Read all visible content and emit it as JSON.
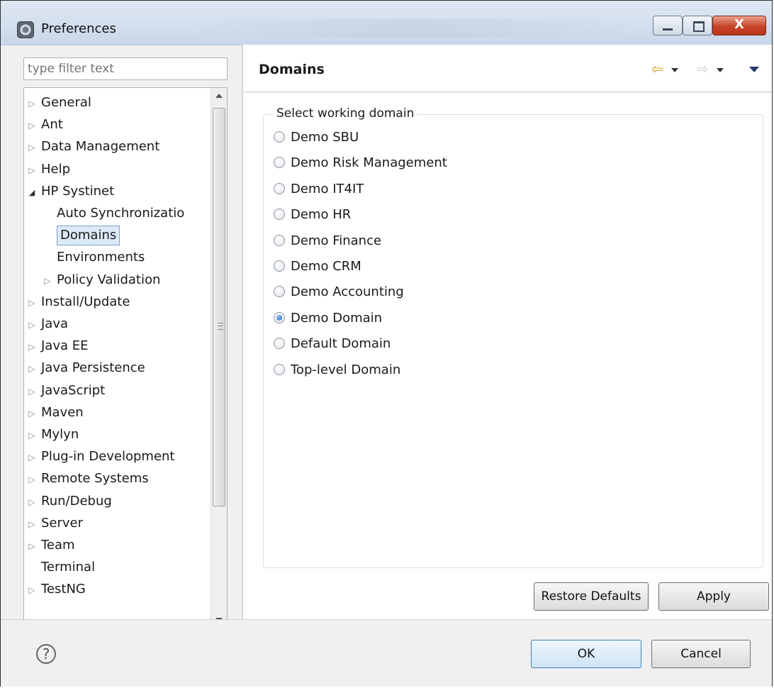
{
  "window": {
    "title": "Preferences",
    "close_glyph": "X"
  },
  "filter": {
    "placeholder": "type filter text"
  },
  "tree": {
    "items": [
      {
        "label": "General",
        "level": 0,
        "expander": "collapsed"
      },
      {
        "label": "Ant",
        "level": 0,
        "expander": "collapsed"
      },
      {
        "label": "Data Management",
        "level": 0,
        "expander": "collapsed"
      },
      {
        "label": "Help",
        "level": 0,
        "expander": "collapsed"
      },
      {
        "label": "HP Systinet",
        "level": 0,
        "expander": "expanded"
      },
      {
        "label": "Auto Synchronizatio",
        "level": 1,
        "expander": "none"
      },
      {
        "label": "Domains",
        "level": 1,
        "expander": "none",
        "selected": true
      },
      {
        "label": "Environments",
        "level": 1,
        "expander": "none"
      },
      {
        "label": "Policy Validation",
        "level": 1,
        "expander": "collapsed"
      },
      {
        "label": "Install/Update",
        "level": 0,
        "expander": "collapsed"
      },
      {
        "label": "Java",
        "level": 0,
        "expander": "collapsed"
      },
      {
        "label": "Java EE",
        "level": 0,
        "expander": "collapsed"
      },
      {
        "label": "Java Persistence",
        "level": 0,
        "expander": "collapsed"
      },
      {
        "label": "JavaScript",
        "level": 0,
        "expander": "collapsed"
      },
      {
        "label": "Maven",
        "level": 0,
        "expander": "collapsed"
      },
      {
        "label": "Mylyn",
        "level": 0,
        "expander": "collapsed"
      },
      {
        "label": "Plug-in Development",
        "level": 0,
        "expander": "collapsed"
      },
      {
        "label": "Remote Systems",
        "level": 0,
        "expander": "collapsed"
      },
      {
        "label": "Run/Debug",
        "level": 0,
        "expander": "collapsed"
      },
      {
        "label": "Server",
        "level": 0,
        "expander": "collapsed"
      },
      {
        "label": "Team",
        "level": 0,
        "expander": "collapsed"
      },
      {
        "label": "Terminal",
        "level": 0,
        "expander": "none"
      },
      {
        "label": "TestNG",
        "level": 0,
        "expander": "collapsed"
      }
    ]
  },
  "page": {
    "title": "Domains",
    "group_label": "Select working domain",
    "options": [
      {
        "label": "Demo SBU",
        "checked": false
      },
      {
        "label": "Demo Risk Management",
        "checked": false
      },
      {
        "label": "Demo IT4IT",
        "checked": false
      },
      {
        "label": "Demo HR",
        "checked": false
      },
      {
        "label": "Demo Finance",
        "checked": false
      },
      {
        "label": "Demo CRM",
        "checked": false
      },
      {
        "label": "Demo Accounting",
        "checked": false
      },
      {
        "label": "Demo Domain",
        "checked": true
      },
      {
        "label": "Default Domain",
        "checked": false
      },
      {
        "label": "Top-level Domain",
        "checked": false
      }
    ],
    "restore_label": "Restore Defaults",
    "apply_label": "Apply"
  },
  "footer": {
    "help_glyph": "?",
    "ok_label": "OK",
    "cancel_label": "Cancel"
  },
  "colors": {
    "accent": "#3c7fb1",
    "selection": "#dde9f6",
    "back_arrow": "#e0a21e"
  }
}
